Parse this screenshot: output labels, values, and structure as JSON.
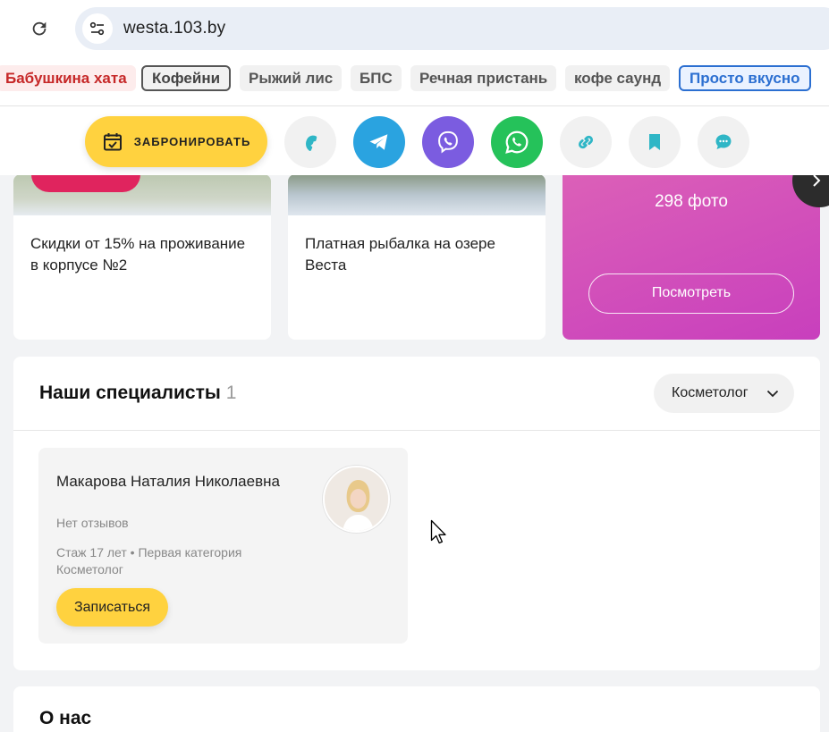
{
  "browser": {
    "url": "westa.103.by"
  },
  "bookmarks": [
    {
      "label": "Бабушкина хата",
      "style": "red"
    },
    {
      "label": "Кофейни",
      "style": "outlined"
    },
    {
      "label": "Рыжий лис",
      "style": "plain"
    },
    {
      "label": "БПС",
      "style": "plain"
    },
    {
      "label": "Речная пристань",
      "style": "plain"
    },
    {
      "label": "кофе саунд",
      "style": "plain"
    },
    {
      "label": "Просто вкусно",
      "style": "blue"
    }
  ],
  "action_bar": {
    "book_label": "ЗАБРОНИРОВАТЬ",
    "buttons": [
      {
        "icon": "phone-icon",
        "bg": "#f1f1f1",
        "color": "#2fb6c6"
      },
      {
        "icon": "telegram-icon",
        "bg": "#2aa3e0",
        "color": "#ffffff"
      },
      {
        "icon": "viber-icon",
        "bg": "#7b5ce0",
        "color": "#ffffff"
      },
      {
        "icon": "whatsapp-icon",
        "bg": "#25c25a",
        "color": "#ffffff"
      },
      {
        "icon": "link-icon",
        "bg": "#f1f1f1",
        "color": "#2fb6c6"
      },
      {
        "icon": "bookmark-icon",
        "bg": "#f1f1f1",
        "color": "#2fb6c6"
      },
      {
        "icon": "chat-icon",
        "bg": "#f1f1f1",
        "color": "#2fb6c6"
      }
    ]
  },
  "cards": {
    "promo_title": "Скидки от 15% на проживание в корпусе №2",
    "fishing_title": "Платная рыбалка на озере Веста",
    "photos_count": "298 фото",
    "photos_button": "Посмотреть"
  },
  "specialists": {
    "title": "Наши специалисты",
    "count": "1",
    "filter_value": "Косметолог",
    "items": [
      {
        "name": "Макарова Наталия Николаевна",
        "reviews": "Нет отзывов",
        "experience": "Стаж 17 лет • Первая категория",
        "role": "Косметолог",
        "book_label": "Записаться"
      }
    ]
  },
  "about": {
    "title": "О нас"
  },
  "colors": {
    "accent_yellow": "#ffd23f",
    "photos_gradient": "#c83fbd",
    "promo_pink": "#e0245e"
  }
}
